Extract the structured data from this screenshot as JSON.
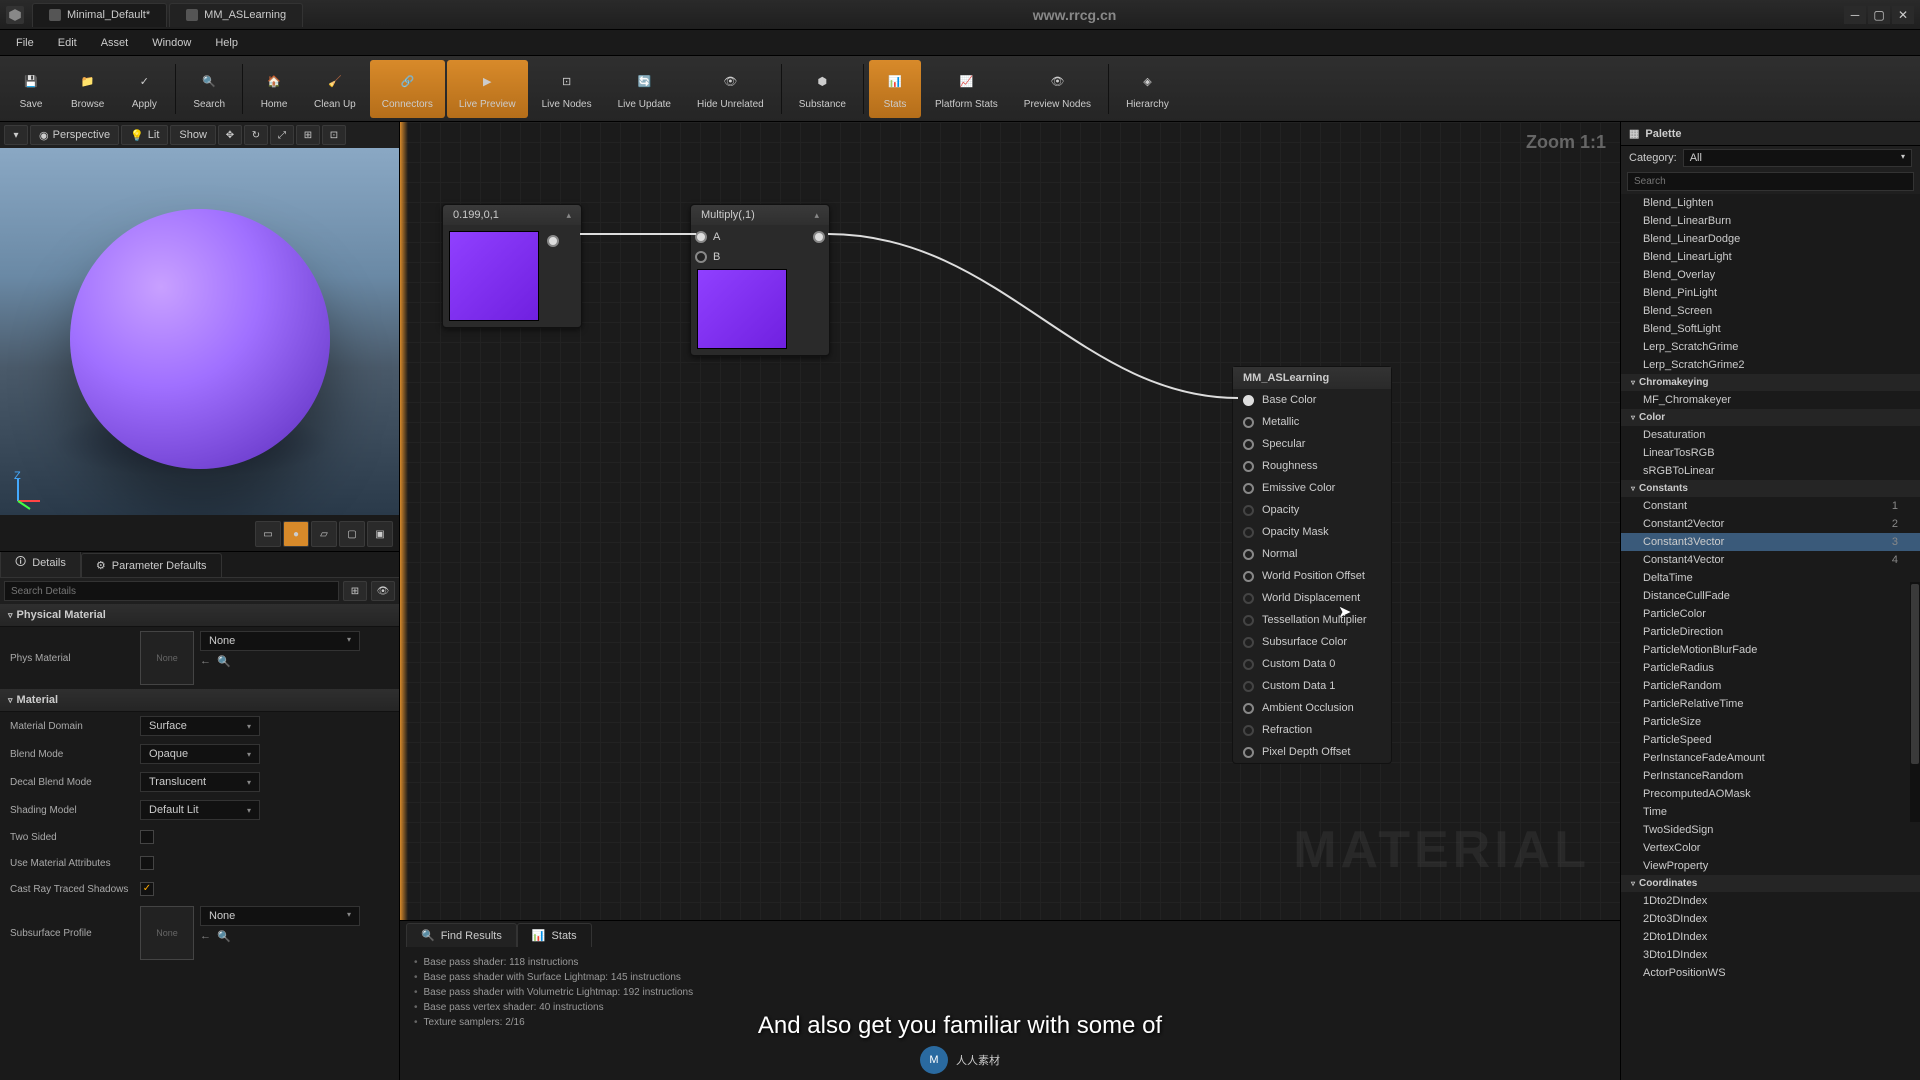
{
  "titlebar": {
    "tabs": [
      {
        "label": "Minimal_Default*"
      },
      {
        "label": "MM_ASLearning"
      }
    ],
    "url": "www.rrcg.cn"
  },
  "menubar": [
    "File",
    "Edit",
    "Asset",
    "Window",
    "Help"
  ],
  "toolbar": [
    {
      "label": "Save",
      "active": false
    },
    {
      "label": "Browse",
      "active": false
    },
    {
      "label": "Apply",
      "active": false
    },
    {
      "label": "Search",
      "active": false
    },
    {
      "label": "Home",
      "active": false
    },
    {
      "label": "Clean Up",
      "active": false
    },
    {
      "label": "Connectors",
      "active": true
    },
    {
      "label": "Live Preview",
      "active": true
    },
    {
      "label": "Live Nodes",
      "active": false
    },
    {
      "label": "Live Update",
      "active": false
    },
    {
      "label": "Hide Unrelated",
      "active": false
    },
    {
      "label": "Substance",
      "active": false
    },
    {
      "label": "Stats",
      "active": true
    },
    {
      "label": "Platform Stats",
      "active": false
    },
    {
      "label": "Preview Nodes",
      "active": false
    },
    {
      "label": "Hierarchy",
      "active": false
    }
  ],
  "viewport": {
    "buttons": [
      "Perspective",
      "Lit",
      "Show"
    ],
    "dropdown_arrow": "▾"
  },
  "details": {
    "tabs": [
      {
        "label": "Details",
        "active": true
      },
      {
        "label": "Parameter Defaults",
        "active": false
      }
    ],
    "search_placeholder": "Search Details",
    "sections": {
      "physical_material": {
        "title": "Physical Material",
        "phys_material": {
          "label": "Phys Material",
          "thumb": "None",
          "dd": "None"
        }
      },
      "material": {
        "title": "Material",
        "rows": [
          {
            "label": "Material Domain",
            "value": "Surface",
            "type": "dd"
          },
          {
            "label": "Blend Mode",
            "value": "Opaque",
            "type": "dd"
          },
          {
            "label": "Decal Blend Mode",
            "value": "Translucent",
            "type": "dd"
          },
          {
            "label": "Shading Model",
            "value": "Default Lit",
            "type": "dd"
          },
          {
            "label": "Two Sided",
            "value": false,
            "type": "cb"
          },
          {
            "label": "Use Material Attributes",
            "value": false,
            "type": "cb"
          },
          {
            "label": "Cast Ray Traced Shadows",
            "value": true,
            "type": "cb"
          },
          {
            "label": "Subsurface Profile",
            "thumb": "None",
            "dd": "None",
            "type": "thumb"
          }
        ]
      }
    }
  },
  "graph": {
    "zoom": "Zoom 1:1",
    "watermark": "MATERIAL",
    "nodes": {
      "const3v": {
        "title": "0.199,0,1"
      },
      "multiply": {
        "title": "Multiply(,1)",
        "pins": [
          "A",
          "B"
        ]
      },
      "main": {
        "title": "MM_ASLearning",
        "pins": [
          {
            "label": "Base Color",
            "enabled": true,
            "filled": true
          },
          {
            "label": "Metallic",
            "enabled": true
          },
          {
            "label": "Specular",
            "enabled": true
          },
          {
            "label": "Roughness",
            "enabled": true
          },
          {
            "label": "Emissive Color",
            "enabled": true
          },
          {
            "label": "Opacity",
            "enabled": false
          },
          {
            "label": "Opacity Mask",
            "enabled": false
          },
          {
            "label": "Normal",
            "enabled": true
          },
          {
            "label": "World Position Offset",
            "enabled": true
          },
          {
            "label": "World Displacement",
            "enabled": false
          },
          {
            "label": "Tessellation Multiplier",
            "enabled": false
          },
          {
            "label": "Subsurface Color",
            "enabled": false
          },
          {
            "label": "Custom Data 0",
            "enabled": false
          },
          {
            "label": "Custom Data 1",
            "enabled": false
          },
          {
            "label": "Ambient Occlusion",
            "enabled": true
          },
          {
            "label": "Refraction",
            "enabled": false
          },
          {
            "label": "Pixel Depth Offset",
            "enabled": true
          }
        ]
      }
    }
  },
  "bottom": {
    "tabs": [
      {
        "label": "Find Results",
        "active": true
      },
      {
        "label": "Stats",
        "active": false
      }
    ],
    "lines": [
      "Base pass shader: 118 instructions",
      "Base pass shader with Surface Lightmap: 145 instructions",
      "Base pass shader with Volumetric Lightmap: 192 instructions",
      "Base pass vertex shader: 40 instructions",
      "Texture samplers: 2/16"
    ]
  },
  "palette": {
    "title": "Palette",
    "category_label": "Category:",
    "category_value": "All",
    "search_placeholder": "Search",
    "items": [
      {
        "label": "Blend_Lighten"
      },
      {
        "label": "Blend_LinearBurn"
      },
      {
        "label": "Blend_LinearDodge"
      },
      {
        "label": "Blend_LinearLight"
      },
      {
        "label": "Blend_Overlay"
      },
      {
        "label": "Blend_PinLight"
      },
      {
        "label": "Blend_Screen"
      },
      {
        "label": "Blend_SoftLight"
      },
      {
        "label": "Lerp_ScratchGrime"
      },
      {
        "label": "Lerp_ScratchGrime2"
      },
      {
        "group": "Chromakeying"
      },
      {
        "label": "MF_Chromakeyer"
      },
      {
        "group": "Color"
      },
      {
        "label": "Desaturation"
      },
      {
        "label": "LinearTosRGB"
      },
      {
        "label": "sRGBToLinear"
      },
      {
        "group": "Constants"
      },
      {
        "label": "Constant",
        "sc": "1"
      },
      {
        "label": "Constant2Vector",
        "sc": "2"
      },
      {
        "label": "Constant3Vector",
        "sc": "3",
        "sel": true
      },
      {
        "label": "Constant4Vector",
        "sc": "4"
      },
      {
        "label": "DeltaTime"
      },
      {
        "label": "DistanceCullFade"
      },
      {
        "label": "ParticleColor"
      },
      {
        "label": "ParticleDirection"
      },
      {
        "label": "ParticleMotionBlurFade"
      },
      {
        "label": "ParticleRadius"
      },
      {
        "label": "ParticleRandom"
      },
      {
        "label": "ParticleRelativeTime"
      },
      {
        "label": "ParticleSize"
      },
      {
        "label": "ParticleSpeed"
      },
      {
        "label": "PerInstanceFadeAmount"
      },
      {
        "label": "PerInstanceRandom"
      },
      {
        "label": "PrecomputedAOMask"
      },
      {
        "label": "Time"
      },
      {
        "label": "TwoSidedSign"
      },
      {
        "label": "VertexColor"
      },
      {
        "label": "ViewProperty"
      },
      {
        "group": "Coordinates"
      },
      {
        "label": "1Dto2DIndex"
      },
      {
        "label": "2Dto3DIndex"
      },
      {
        "label": "2Dto1DIndex"
      },
      {
        "label": "3Dto1DIndex"
      },
      {
        "label": "ActorPositionWS"
      }
    ]
  },
  "subtitle": "And also get you familiar with some of",
  "footer_logo": "人人素材"
}
